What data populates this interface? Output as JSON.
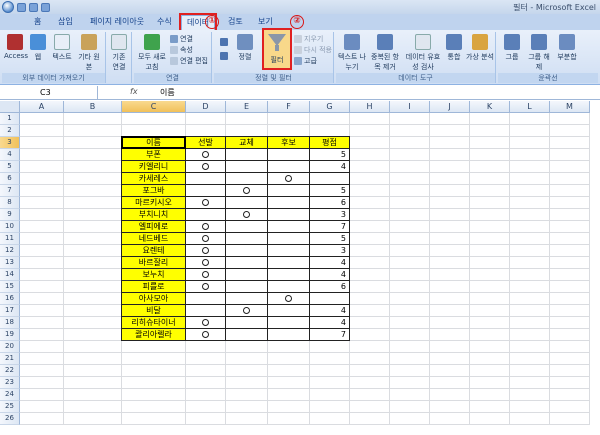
{
  "window": {
    "title": "필터 - Microsoft Excel"
  },
  "tabs": [
    "홈",
    "삽입",
    "페이지 레이아웃",
    "수식",
    "데이터",
    "검토",
    "보기"
  ],
  "active_tab": "데이터",
  "markers": [
    "①",
    "②"
  ],
  "ribbon": {
    "groups": [
      {
        "name": "외부 데이터 가져오기",
        "buttons": [
          "Access",
          "웹",
          "텍스트",
          "기타 원본",
          "기존 연결"
        ]
      },
      {
        "name": "연결",
        "buttons": [
          "모두 새로 고침",
          "연결",
          "속성",
          "연결 편집"
        ]
      },
      {
        "name": "정렬 및 필터",
        "buttons": [
          "정렬",
          "필터",
          "지우기",
          "다시 적용",
          "고급"
        ]
      },
      {
        "name": "데이터 도구",
        "buttons": [
          "텍스트 나누기",
          "중복된 항목 제거",
          "데이터 유효성 검사",
          "통합",
          "가상 분석"
        ]
      },
      {
        "name": "윤곽선",
        "buttons": [
          "그룹",
          "그룹 해제",
          "부분합"
        ]
      }
    ]
  },
  "formula_bar": {
    "name_box": "C3",
    "fx": "fx",
    "value": "이름"
  },
  "columns": [
    "A",
    "B",
    "C",
    "D",
    "E",
    "F",
    "G",
    "H",
    "I",
    "J",
    "K",
    "L",
    "M"
  ],
  "rows": [
    "1",
    "2",
    "3",
    "4",
    "5",
    "6",
    "7",
    "8",
    "9",
    "10",
    "11",
    "12",
    "13",
    "14",
    "15",
    "16",
    "17",
    "18",
    "19",
    "20",
    "21",
    "22",
    "23",
    "24",
    "25",
    "26"
  ],
  "table": {
    "headers": [
      "이름",
      "선발",
      "교체",
      "후보",
      "평점"
    ],
    "rows": [
      [
        "부폰",
        "O",
        "",
        "",
        "5"
      ],
      [
        "키엘리니",
        "O",
        "",
        "",
        "4"
      ],
      [
        "카세레스",
        "",
        "",
        "O",
        ""
      ],
      [
        "포그바",
        "",
        "O",
        "",
        "5"
      ],
      [
        "마르키시오",
        "O",
        "",
        "",
        "6"
      ],
      [
        "부치니치",
        "",
        "O",
        "",
        "3"
      ],
      [
        "엘피에로",
        "O",
        "",
        "",
        "7"
      ],
      [
        "네드베드",
        "O",
        "",
        "",
        "5"
      ],
      [
        "요렌테",
        "O",
        "",
        "",
        "3"
      ],
      [
        "바르잘리",
        "O",
        "",
        "",
        "4"
      ],
      [
        "보누치",
        "O",
        "",
        "",
        "4"
      ],
      [
        "피를로",
        "O",
        "",
        "",
        "6"
      ],
      [
        "아사모아",
        "",
        "",
        "O",
        ""
      ],
      [
        "비달",
        "",
        "O",
        "",
        "4"
      ],
      [
        "리히슈타이너",
        "O",
        "",
        "",
        "4"
      ],
      [
        "콸리아렐라",
        "O",
        "",
        "",
        "7"
      ]
    ]
  },
  "colors": {
    "header_fill": "#ffff00",
    "name_fill": "#ffff00",
    "highlight": "#e02020"
  }
}
